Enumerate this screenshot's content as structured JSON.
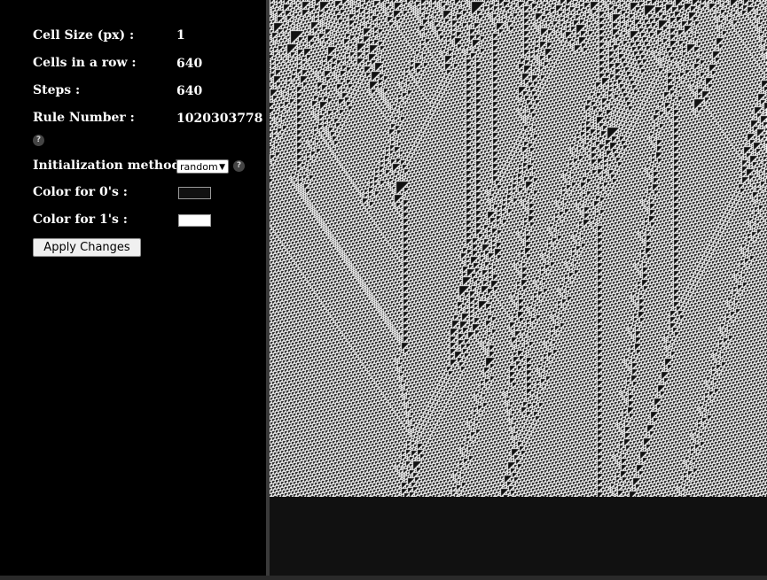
{
  "settings": {
    "cell_size": {
      "label": "Cell Size (px) :",
      "value": "1"
    },
    "cells_in_row": {
      "label": "Cells in a row :",
      "value": "640"
    },
    "steps": {
      "label": "Steps :",
      "value": "640"
    },
    "rule_number": {
      "label": "Rule Number :",
      "value": "1020303778"
    },
    "help_glyph": "?",
    "init_method": {
      "label": "Initialization method :",
      "selected": "random"
    },
    "color_zero": {
      "label": "Color for 0's :",
      "value": "#111111"
    },
    "color_one": {
      "label": "Color for 1's :",
      "value": "#ffffff"
    },
    "apply_label": "Apply Changes"
  },
  "icons": {
    "help": "question-circle",
    "select_arrow": "chevron-down"
  }
}
